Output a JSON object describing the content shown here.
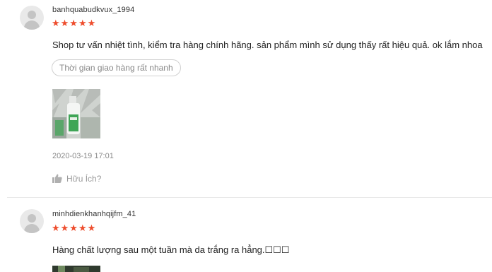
{
  "reviews": [
    {
      "username": "banhquabudkvux_1994",
      "stars": "★★★★★",
      "comment": "Shop tư vấn nhiệt tình, kiểm tra hàng chính hãng. sản phẩm mình sử dụng thấy rất hiệu quả. ok lắm nhoa",
      "tag": "Thời gian giao hàng rất nhanh",
      "date": "2020-03-19 17:01",
      "helpful": "Hữu Ích?"
    },
    {
      "username": "minhdienkhanhqijfm_41",
      "stars": "★★★★★",
      "comment": "Hàng chất lượng sau một tuần mà da trắng ra hẳng.☐☐☐"
    }
  ],
  "colors": {
    "star": "#ee4d2d",
    "muted": "#888888",
    "divider": "#e8e8e8"
  }
}
